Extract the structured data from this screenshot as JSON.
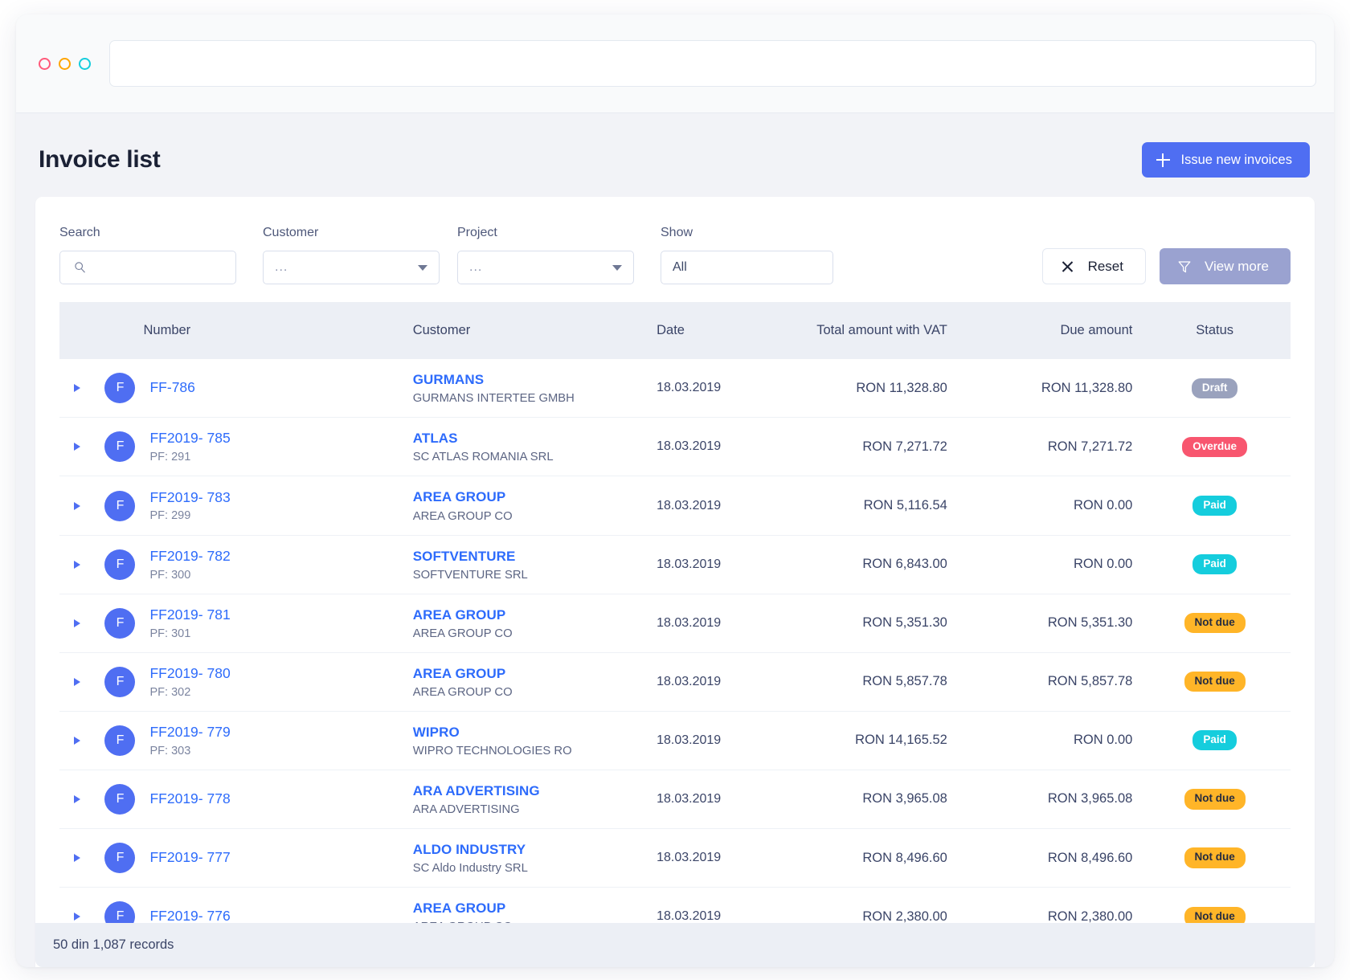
{
  "window_controls": [
    {
      "name": "close-dot",
      "color": "#ff5a7a"
    },
    {
      "name": "minimize-dot",
      "color": "#ffa502"
    },
    {
      "name": "maximize-dot",
      "color": "#15cddd"
    }
  ],
  "urlbar": {
    "value": "",
    "placeholder": ""
  },
  "header": {
    "title": "Invoice list",
    "issue_button_label": "Issue new invoices",
    "issue_button_icon": "plus-icon",
    "accent_color": "#4f6ef2"
  },
  "filters": {
    "search": {
      "label": "Search",
      "value": "",
      "placeholder": "",
      "icon": "search-icon"
    },
    "customer": {
      "label": "Customer",
      "value": "...",
      "icon": "chevron-down-icon"
    },
    "project": {
      "label": "Project",
      "value": "...",
      "icon": "chevron-down-icon"
    },
    "show": {
      "label": "Show",
      "value": "All"
    },
    "reset_label": "Reset",
    "reset_icon": "close-icon",
    "view_more_label": "View more",
    "view_more_icon": "filter-icon"
  },
  "table": {
    "columns": [
      {
        "key": "expand",
        "label": ""
      },
      {
        "key": "number",
        "label": "Number"
      },
      {
        "key": "customer",
        "label": "Customer"
      },
      {
        "key": "date",
        "label": "Date"
      },
      {
        "key": "total",
        "label": "Total amount with VAT"
      },
      {
        "key": "due",
        "label": "Due amount"
      },
      {
        "key": "status",
        "label": "Status"
      }
    ],
    "rows": [
      {
        "avatar": "F",
        "number": "FF-786",
        "sub": "",
        "customer": "GURMANS",
        "customer_sub": "GURMANS INTERTEE GMBH",
        "date": "18.03.2019",
        "total": "RON 11,328.80",
        "due": "RON 11,328.80",
        "status": "Draft",
        "status_class": "draft"
      },
      {
        "avatar": "F",
        "number": "FF2019- 785",
        "sub": "PF: 291",
        "customer": "ATLAS",
        "customer_sub": "SC ATLAS ROMANIA SRL",
        "date": "18.03.2019",
        "total": "RON 7,271.72",
        "due": "RON 7,271.72",
        "status": "Overdue",
        "status_class": "overdue"
      },
      {
        "avatar": "F",
        "number": "FF2019- 783",
        "sub": "PF: 299",
        "customer": "AREA GROUP",
        "customer_sub": "AREA GROUP CO",
        "date": "18.03.2019",
        "total": "RON 5,116.54",
        "due": "RON 0.00",
        "status": "Paid",
        "status_class": "paid"
      },
      {
        "avatar": "F",
        "number": "FF2019- 782",
        "sub": "PF: 300",
        "customer": "SOFTVENTURE",
        "customer_sub": "SOFTVENTURE SRL",
        "date": "18.03.2019",
        "total": "RON 6,843.00",
        "due": "RON 0.00",
        "status": "Paid",
        "status_class": "paid"
      },
      {
        "avatar": "F",
        "number": "FF2019- 781",
        "sub": "PF: 301",
        "customer": "AREA GROUP",
        "customer_sub": "AREA GROUP CO",
        "date": "18.03.2019",
        "total": "RON 5,351.30",
        "due": "RON 5,351.30",
        "status": "Not due",
        "status_class": "notdue"
      },
      {
        "avatar": "F",
        "number": "FF2019- 780",
        "sub": "PF: 302",
        "customer": "AREA GROUP",
        "customer_sub": "AREA GROUP CO",
        "date": "18.03.2019",
        "total": "RON 5,857.78",
        "due": "RON 5,857.78",
        "status": "Not due",
        "status_class": "notdue"
      },
      {
        "avatar": "F",
        "number": "FF2019- 779",
        "sub": "PF: 303",
        "customer": "WIPRO",
        "customer_sub": "WIPRO TECHNOLOGIES RO",
        "date": "18.03.2019",
        "total": "RON 14,165.52",
        "due": "RON 0.00",
        "status": "Paid",
        "status_class": "paid"
      },
      {
        "avatar": "F",
        "number": "FF2019- 778",
        "sub": "",
        "customer": "ARA ADVERTISING",
        "customer_sub": "ARA ADVERTISING",
        "date": "18.03.2019",
        "total": "RON 3,965.08",
        "due": "RON 3,965.08",
        "status": "Not due",
        "status_class": "notdue"
      },
      {
        "avatar": "F",
        "number": "FF2019- 777",
        "sub": "",
        "customer": "ALDO INDUSTRY",
        "customer_sub": "SC Aldo Industry SRL",
        "date": "18.03.2019",
        "total": "RON 8,496.60",
        "due": "RON 8,496.60",
        "status": "Not due",
        "status_class": "notdue"
      },
      {
        "avatar": "F",
        "number": "FF2019- 776",
        "sub": "",
        "customer": "AREA GROUP",
        "customer_sub": "AREA GROUP CO",
        "date": "18.03.2019",
        "total": "RON 2,380.00",
        "due": "RON 2,380.00",
        "status": "Not due",
        "status_class": "notdue"
      }
    ]
  },
  "footer": {
    "records_text": "50 din 1,087 records"
  }
}
